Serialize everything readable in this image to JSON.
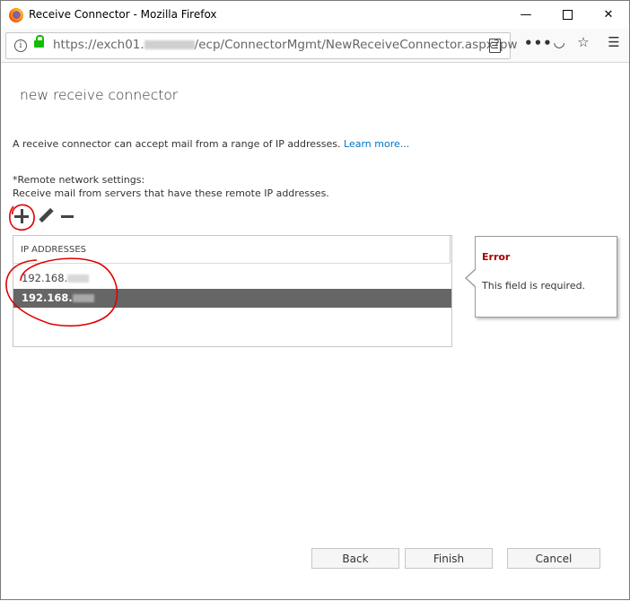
{
  "window": {
    "title": "Receive Connector - Mozilla Firefox",
    "minimize_glyph": "—",
    "close_glyph": "✕"
  },
  "address_bar": {
    "url_prefix": "https://exch01.",
    "url_suffix": "/ecp/ConnectorMgmt/NewReceiveConnector.aspx?pw",
    "more_glyph": "•••",
    "star_glyph": "☆",
    "menu_glyph": "☰",
    "pocket_glyph": "◡"
  },
  "dialog": {
    "title": "new receive connector",
    "intro_text": "A receive connector can accept mail from a range of IP addresses. ",
    "learn_more": "Learn more...",
    "remote_label": "*Remote network settings:",
    "remote_desc": "Receive mail from servers that have these remote IP addresses."
  },
  "ip_list": {
    "header": "IP ADDRESSES",
    "rows": [
      {
        "value": "192.168.",
        "selected": false
      },
      {
        "value": "192.168.",
        "selected": true
      }
    ]
  },
  "error_callout": {
    "title": "Error",
    "message": "This field is required."
  },
  "buttons": {
    "back": "Back",
    "finish": "Finish",
    "cancel": "Cancel"
  },
  "colors": {
    "selected_row": "#666666",
    "error_title": "#a80000",
    "link": "#0072c6",
    "annotation": "#e00000"
  }
}
